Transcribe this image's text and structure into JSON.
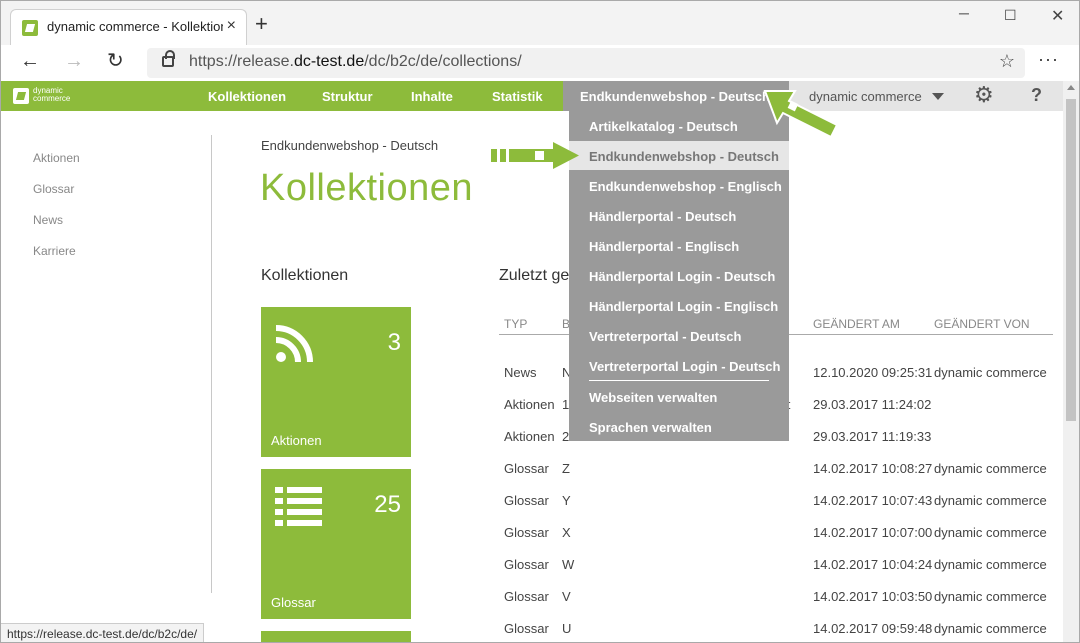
{
  "browser": {
    "tab_title": "dynamic commerce - Kollektione",
    "tab_close": "×",
    "new_tab": "+",
    "url_prefix": "https://release.",
    "url_domain": "dc-test.de",
    "url_path": "/dc/b2c/de/collections/",
    "status_url": "https://release.dc-test.de/dc/b2c/de/"
  },
  "header": {
    "logo_text": "dynamic commerce",
    "nav": [
      "Kollektionen",
      "Struktur",
      "Inhalte",
      "Statistik"
    ],
    "shop_selector": "Endkundenwebshop - Deutsch",
    "user_selector": "dynamic commerce",
    "help": "?"
  },
  "sidebar": {
    "items": [
      "Aktionen",
      "Glossar",
      "News",
      "Karriere"
    ]
  },
  "main": {
    "breadcrumb": "Endkundenwebshop - Deutsch",
    "title": "Kollektionen",
    "collections_heading": "Kollektionen",
    "recent_heading": "Zuletzt ge",
    "tiles": [
      {
        "label": "Aktionen",
        "count": "3",
        "icon": "rss-icon"
      },
      {
        "label": "Glossar",
        "count": "25",
        "icon": "list-icon"
      }
    ],
    "table": {
      "columns": [
        "TYP",
        "B",
        "GEÄNDERT AM",
        "GEÄNDERT VON"
      ],
      "rows": [
        {
          "typ": "News",
          "b": "N",
          "extra": "",
          "date": "12.10.2020 09:25:31",
          "by": "dynamic commerce"
        },
        {
          "typ": "Aktionen",
          "b": "1",
          "extra": "nkt",
          "date": "29.03.2017 11:24:02",
          "by": ""
        },
        {
          "typ": "Aktionen",
          "b": "2",
          "extra": "",
          "date": "29.03.2017 11:19:33",
          "by": ""
        },
        {
          "typ": "Glossar",
          "b": "Z",
          "extra": "",
          "date": "14.02.2017 10:08:27",
          "by": "dynamic commerce"
        },
        {
          "typ": "Glossar",
          "b": "Y",
          "extra": "",
          "date": "14.02.2017 10:07:43",
          "by": "dynamic commerce"
        },
        {
          "typ": "Glossar",
          "b": "X",
          "extra": "",
          "date": "14.02.2017 10:07:00",
          "by": "dynamic commerce"
        },
        {
          "typ": "Glossar",
          "b": "W",
          "extra": "",
          "date": "14.02.2017 10:04:24",
          "by": "dynamic commerce"
        },
        {
          "typ": "Glossar",
          "b": "V",
          "extra": "",
          "date": "14.02.2017 10:03:50",
          "by": "dynamic commerce"
        },
        {
          "typ": "Glossar",
          "b": "U",
          "extra": "",
          "date": "14.02.2017 09:59:48",
          "by": "dynamic commerce"
        }
      ]
    }
  },
  "dropdown": {
    "items": [
      "Artikelkatalog - Deutsch",
      "Endkundenwebshop - Deutsch",
      "Endkundenwebshop - Englisch",
      "Händlerportal - Deutsch",
      "Händlerportal - Englisch",
      "Händlerportal Login - Deutsch",
      "Händlerportal Login - Englisch",
      "Vertreterportal - Deutsch",
      "Vertreterportal Login - Deutsch"
    ],
    "actions": [
      "Webseiten verwalten",
      "Sprachen verwalten"
    ],
    "selected_index": 1
  },
  "colors": {
    "brand_green": "#8dbb3b",
    "dropdown_gray": "#9a9a9a"
  }
}
